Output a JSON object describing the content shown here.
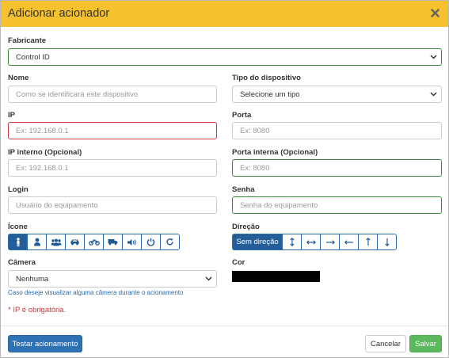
{
  "modal": {
    "title": "Adicionar acionador"
  },
  "manufacturer": {
    "label": "Fabricante",
    "value": "Control ID"
  },
  "name": {
    "label": "Nome",
    "placeholder": "Como se identificará este dispositivo"
  },
  "device_type": {
    "label": "Tipo do dispositivo",
    "value": "Selecione um tipo"
  },
  "ip": {
    "label": "IP",
    "placeholder": "Ex: 192.168.0.1"
  },
  "port": {
    "label": "Porta",
    "placeholder": "Ex: 8080"
  },
  "internal_ip": {
    "label": "IP interno (Opcional)",
    "placeholder": "Ex: 192.168.0.1"
  },
  "internal_port": {
    "label": "Porta interna (Opcional)",
    "placeholder": "Ex: 8080"
  },
  "login": {
    "label": "Login",
    "placeholder": "Usuário do equipamento"
  },
  "password": {
    "label": "Senha",
    "placeholder": "Senha do equipamento"
  },
  "icon_group": {
    "label": "Ícone",
    "options": [
      "person-icon",
      "user-icon",
      "group-icon",
      "car-icon",
      "motorcycle-icon",
      "truck-icon",
      "speaker-icon",
      "power-icon",
      "refresh-icon"
    ],
    "selected": "person-icon"
  },
  "direction_group": {
    "label": "Direção",
    "selected_label": "Sem direção",
    "options": [
      "vertical-arrows-icon",
      "horizontal-arrows-icon",
      "arrow-right-icon",
      "arrow-left-icon",
      "arrow-up-icon",
      "arrow-down-icon"
    ]
  },
  "camera": {
    "label": "Câmera",
    "value": "Nenhuma",
    "hint": "Caso deseje visualizar alguma câmera durante o acionamento"
  },
  "color": {
    "label": "Cor",
    "value": "#000000"
  },
  "validation": {
    "message": "* IP é obrigatória."
  },
  "footer": {
    "test_label": "Testar acionamento",
    "cancel_label": "Cancelar",
    "save_label": "Salvar"
  },
  "colors": {
    "header": "#f5c12e",
    "primary": "#2f72b3",
    "success": "#5cb85c",
    "danger": "#c9393d",
    "valid": "#3c8a3c"
  }
}
